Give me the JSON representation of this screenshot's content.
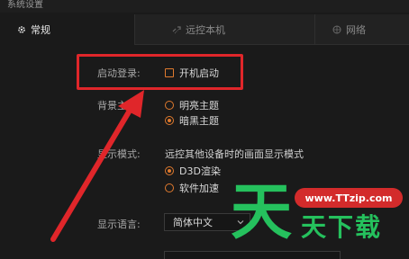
{
  "window": {
    "title": "系统设置"
  },
  "tabs": [
    {
      "label": "常规",
      "icon": "gear-icon",
      "active": true
    },
    {
      "label": "远控本机",
      "icon": "remote-icon",
      "active": false
    },
    {
      "label": "网络",
      "icon": "network-icon",
      "active": false
    }
  ],
  "startup": {
    "label": "启动登录:",
    "option": "开机启动",
    "checked": false
  },
  "theme": {
    "label": "背景主题:",
    "options": [
      {
        "label": "明亮主题",
        "selected": false
      },
      {
        "label": "暗黑主题",
        "selected": true
      }
    ]
  },
  "display_mode": {
    "label": "显示模式:",
    "description": "远控其他设备时的画面显示模式",
    "options": [
      {
        "label": "D3D渲染",
        "selected": true
      },
      {
        "label": "软件加速",
        "selected": false
      }
    ]
  },
  "language": {
    "label": "显示语言:",
    "value": "简体中文"
  },
  "watermark": {
    "url": "www.TTzip.com",
    "big": "天",
    "sub": "天下载"
  },
  "colors": {
    "accent": "#e07a2e",
    "highlight": "#e0262a",
    "watermark": "#25c15d",
    "background": "#1a1a1a"
  }
}
